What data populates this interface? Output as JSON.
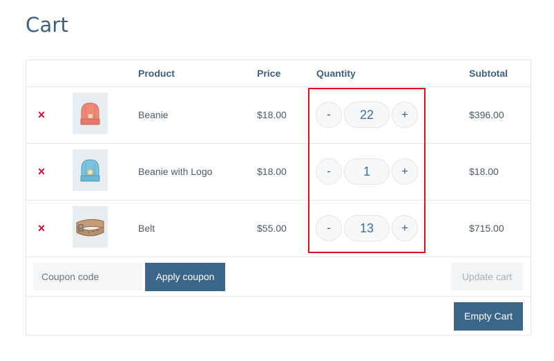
{
  "page": {
    "title": "Cart"
  },
  "table": {
    "headers": {
      "product": "Product",
      "price": "Price",
      "quantity": "Quantity",
      "subtotal": "Subtotal"
    },
    "items": [
      {
        "name": "Beanie",
        "price": "$18.00",
        "quantity": "22",
        "subtotal": "$396.00",
        "thumbnail_icon": "beanie-icon",
        "thumbnail_color": "#f08a78",
        "remove_glyph": "×",
        "minus_label": "-",
        "plus_label": "+"
      },
      {
        "name": "Beanie with Logo",
        "price": "$18.00",
        "quantity": "1",
        "subtotal": "$18.00",
        "thumbnail_icon": "beanie-logo-icon",
        "thumbnail_color": "#7cc3de",
        "remove_glyph": "×",
        "minus_label": "-",
        "plus_label": "+"
      },
      {
        "name": "Belt",
        "price": "$55.00",
        "quantity": "13",
        "subtotal": "$715.00",
        "thumbnail_icon": "belt-icon",
        "thumbnail_color": "#b8906c",
        "remove_glyph": "×",
        "minus_label": "-",
        "plus_label": "+"
      }
    ]
  },
  "actions": {
    "coupon_placeholder": "Coupon code",
    "apply_coupon_label": "Apply coupon",
    "update_cart_label": "Update cart",
    "empty_cart_label": "Empty Cart"
  },
  "colors": {
    "accent": "#3b6589",
    "title": "#3e5f7f",
    "remove": "#e0102a",
    "highlight_box": "#e0101a"
  }
}
